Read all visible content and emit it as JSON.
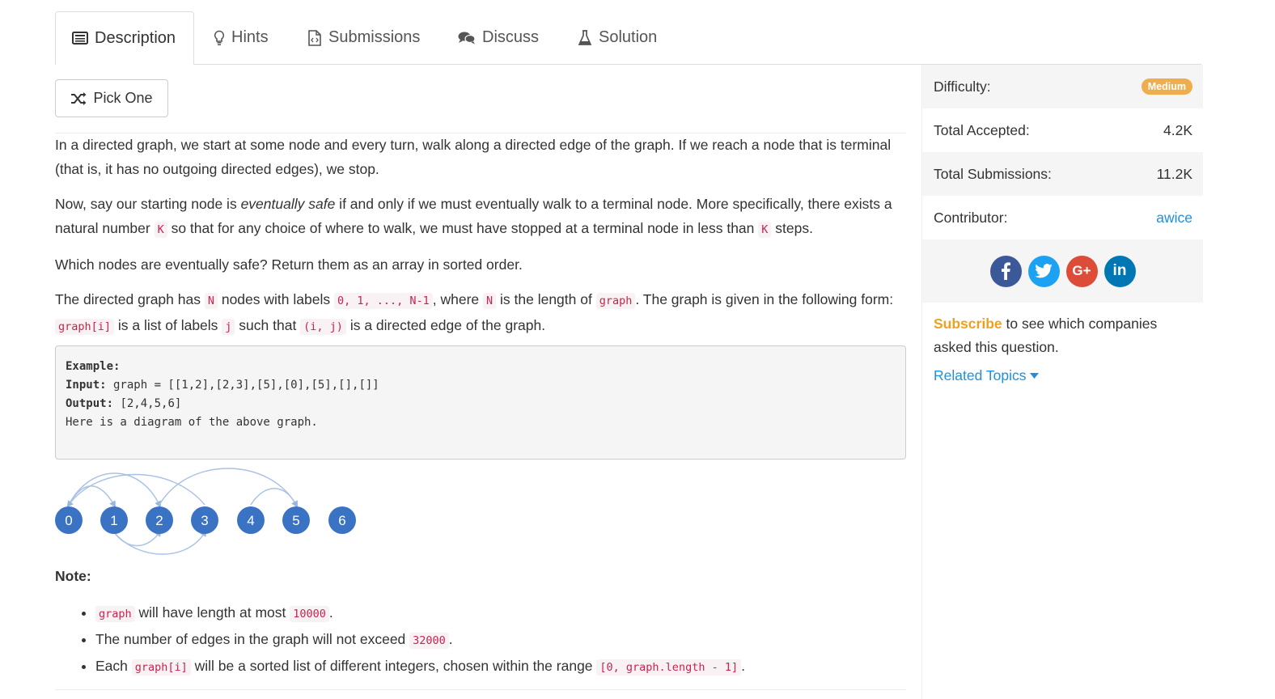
{
  "tabs": [
    {
      "label": "Description",
      "icon": "description-icon"
    },
    {
      "label": "Hints",
      "icon": "lightbulb-icon"
    },
    {
      "label": "Submissions",
      "icon": "code-file-icon"
    },
    {
      "label": "Discuss",
      "icon": "comments-icon"
    },
    {
      "label": "Solution",
      "icon": "flask-icon"
    }
  ],
  "pick_one": "Pick One",
  "description": {
    "p1": "In a directed graph, we start at some node and every turn, walk along a directed edge of the graph.  If we reach a node that is terminal (that is, it has no outgoing directed edges), we stop.",
    "p2_a": "Now, say our starting node is ",
    "p2_em": "eventually safe",
    "p2_b": " if and only if we must eventually walk to a terminal node.  More specifically, there exists a natural number ",
    "p2_code1": "K",
    "p2_c": " so that for any choice of where to walk, we must have stopped at a terminal node in less than ",
    "p2_code2": "K",
    "p2_d": " steps.",
    "p3": "Which nodes are eventually safe?  Return them as an array in sorted order.",
    "p4_a": "The directed graph has ",
    "p4_code1": "N",
    "p4_b": " nodes with labels ",
    "p4_code2": "0, 1, ..., N-1",
    "p4_c": ", where ",
    "p4_code3": "N",
    "p4_d": " is the length of ",
    "p4_code4": "graph",
    "p4_e": ".  The graph is given in the following form: ",
    "p4_code5": "graph[i]",
    "p4_f": " is a list of labels ",
    "p4_code6": "j",
    "p4_g": " such that ",
    "p4_code7": "(i, j)",
    "p4_h": " is a directed edge of the graph."
  },
  "example": {
    "heading": "Example:",
    "input_label": "Input:",
    "input_value": " graph = [[1,2],[2,3],[5],[0],[5],[],[]]",
    "output_label": "Output:",
    "output_value": " [2,4,5,6]",
    "caption": "Here is a diagram of the above graph."
  },
  "graph_nodes": [
    "0",
    "1",
    "2",
    "3",
    "4",
    "5",
    "6"
  ],
  "note_heading": "Note:",
  "notes": [
    {
      "code1": "graph",
      "text1": " will have length at most ",
      "code2": "10000",
      "text2": "."
    },
    {
      "text0": "The number of edges in the graph will not exceed ",
      "code1": "32000",
      "text1": "."
    },
    {
      "text0": "Each ",
      "code1": "graph[i]",
      "text1": " will be a sorted list of different integers, chosen within the range ",
      "code2": "[0, graph.length - 1]",
      "text2": "."
    }
  ],
  "sidebar": {
    "difficulty_label": "Difficulty:",
    "difficulty_value": "Medium",
    "accepted_label": "Total Accepted:",
    "accepted_value": "4.2K",
    "submissions_label": "Total Submissions:",
    "submissions_value": "11.2K",
    "contributor_label": "Contributor:",
    "contributor_value": "awice",
    "social": [
      {
        "icon": "facebook-icon",
        "glyph": "f",
        "color": "#3b5998"
      },
      {
        "icon": "twitter-icon",
        "glyph": "t",
        "color": "#1da1f2"
      },
      {
        "icon": "google-plus-icon",
        "glyph": "G+",
        "color": "#dd4b39"
      },
      {
        "icon": "linkedin-icon",
        "glyph": "in",
        "color": "#0077b5"
      }
    ],
    "subscribe_link": "Subscribe",
    "subscribe_text": " to see which companies asked this question.",
    "related_topics": "Related Topics"
  },
  "colors": {
    "accent": "#1e90dd",
    "badge": "#f0ad4e",
    "node": "#3b73c4"
  }
}
